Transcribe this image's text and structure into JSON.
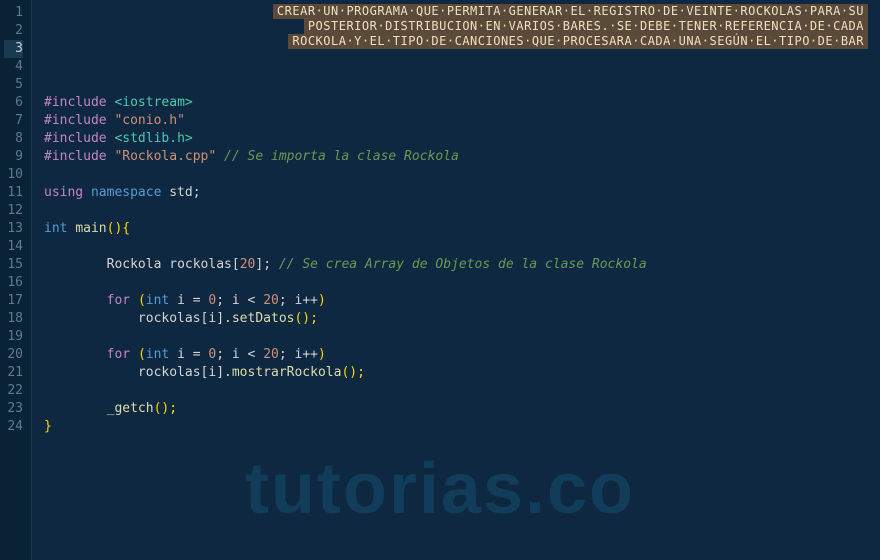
{
  "banner": {
    "line1": "CREAR·UN·PROGRAMA·QUE·PERMITA·GENERAR·EL·REGISTRO·DE·VEINTE·ROCKOLAS·PARA·SU",
    "line2": "POSTERIOR·DISTRIBUCION·EN·VARIOS·BARES.·SE·DEBE·TENER·REFERENCIA·DE·CADA",
    "line3": "ROCKOLA·Y·EL·TIPO·DE·CANCIONES·QUE·PROCESARA·CADA·UNA·SEGÚN·EL·TIPO·DE·BAR"
  },
  "gutter": {
    "start": 1,
    "end": 24,
    "active": 3
  },
  "code": {
    "include1_dir": "#include ",
    "include1_val": "<iostream>",
    "include2_dir": "#include ",
    "include2_val": "\"conio.h\"",
    "include3_dir": "#include ",
    "include3_val": "<stdlib.h>",
    "include4_dir": "#include ",
    "include4_val": "\"Rockola.cpp\"",
    "include4_comment": " // Se importa la clase Rockola",
    "using_kw": "using",
    "namespace_kw": " namespace ",
    "std_id": "std",
    "semi": ";",
    "int_kw": "int ",
    "main_fn": "main",
    "main_parens": "(){",
    "rockola_type": "Rockola ",
    "rockolas_id": "rockolas",
    "arr_open": "[",
    "arr_size": "20",
    "arr_close": "]",
    "arr_comment": " // Se crea Array de Objetos de la clase Rockola",
    "for_kw": "for ",
    "for_open": "(",
    "for_int": "int ",
    "for_i": "i",
    "for_eq": " = ",
    "for_zero": "0",
    "for_semi1": "; ",
    "for_i2": "i",
    "for_lt": " < ",
    "for_limit": "20",
    "for_semi2": "; ",
    "for_i3": "i",
    "for_inc": "++",
    "for_close": ")",
    "body_rockolas": "rockolas",
    "body_idx_open": "[",
    "body_idx": "i",
    "body_idx_close": "]",
    "body_dot": ".",
    "body_setDatos": "setDatos",
    "body_call": "();",
    "body_mostrar": "mostrarRockola",
    "getch_fn": "_getch",
    "getch_call": "();",
    "close_brace": "}"
  },
  "watermark": "tutorias.co"
}
